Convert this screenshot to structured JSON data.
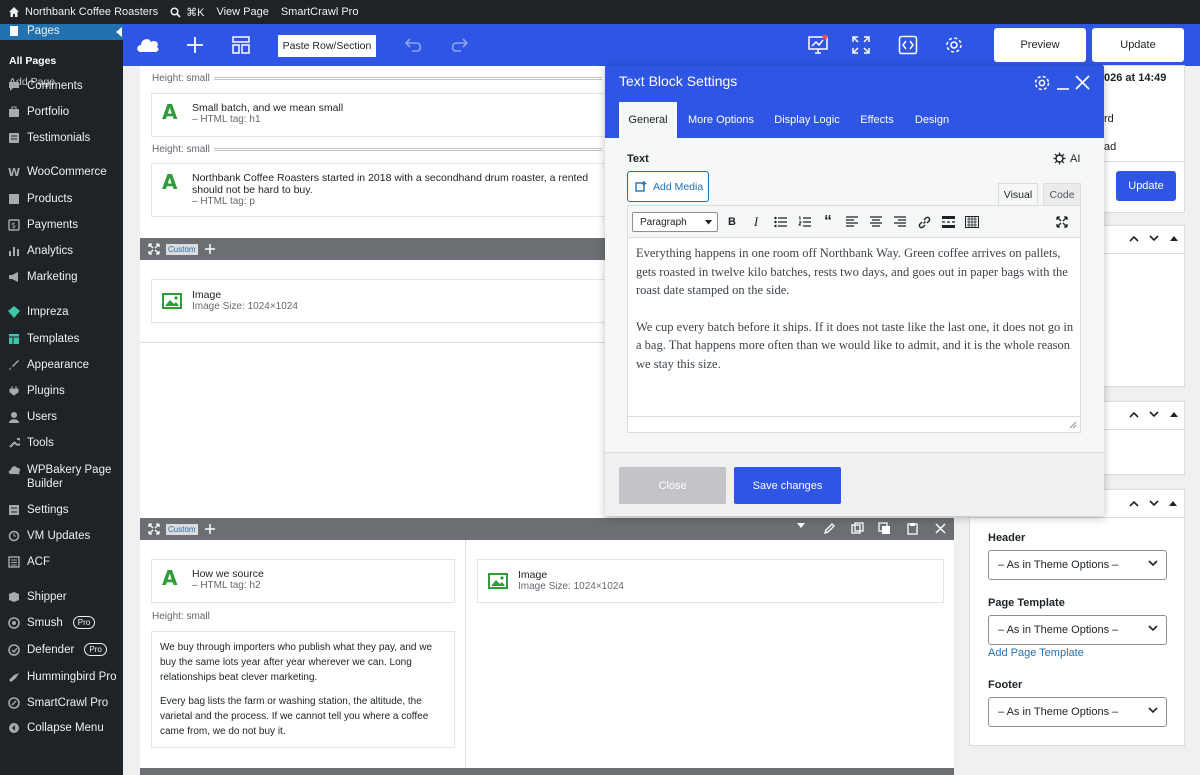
{
  "admin_bar": {
    "site_name": "Northbank Coffee Roasters",
    "search_shortcut": "⌘K",
    "view_page": "View Page",
    "plugin": "SmartCrawl Pro"
  },
  "sidebar": {
    "current": "Pages",
    "sub_items": [
      "All Pages",
      "Add Page"
    ],
    "items": [
      {
        "label": "Comments",
        "icon": "comments-icon"
      },
      {
        "label": "Portfolio",
        "icon": "portfolio-icon"
      },
      {
        "label": "Testimonials",
        "icon": "testimonials-icon"
      },
      {
        "label": "WooCommerce",
        "icon": "woocommerce-icon"
      },
      {
        "label": "Products",
        "icon": "products-icon"
      },
      {
        "label": "Payments",
        "icon": "payments-icon"
      },
      {
        "label": "Analytics",
        "icon": "analytics-icon"
      },
      {
        "label": "Marketing",
        "icon": "marketing-icon"
      },
      {
        "label": "Impreza",
        "icon": "impreza-icon"
      },
      {
        "label": "Templates",
        "icon": "templates-icon"
      },
      {
        "label": "Appearance",
        "icon": "appearance-icon"
      },
      {
        "label": "Plugins",
        "icon": "plugins-icon"
      },
      {
        "label": "Users",
        "icon": "users-icon"
      },
      {
        "label": "Tools",
        "icon": "tools-icon"
      },
      {
        "label": "WPBakery Page Builder",
        "icon": "wpbakery-icon"
      },
      {
        "label": "Settings",
        "icon": "settings-icon"
      },
      {
        "label": "VM Updates",
        "icon": "updates-icon"
      },
      {
        "label": "ACF",
        "icon": "acf-icon"
      },
      {
        "label": "Shipper",
        "icon": "shipper-icon"
      },
      {
        "label": "Smush",
        "icon": "smush-icon",
        "badge": "Pro"
      },
      {
        "label": "Defender",
        "icon": "defender-icon",
        "badge": "Pro"
      },
      {
        "label": "Hummingbird Pro",
        "icon": "hummingbird-icon"
      },
      {
        "label": "SmartCrawl Pro",
        "icon": "smartcrawl-icon"
      },
      {
        "label": "Collapse Menu",
        "icon": "collapse-icon"
      }
    ]
  },
  "toolbar": {
    "paste_label": "Paste Row/Section",
    "preview_label": "Preview",
    "update_label": "Update"
  },
  "canvas": {
    "height_label": "Height: small",
    "custom_label": "Custom",
    "elements": [
      {
        "title": "Small batch, and we mean small",
        "sub": "– HTML tag: h1"
      },
      {
        "title": "Northbank Coffee Roasters started in 2018 with a secondhand drum roaster, a rented",
        "title2": "should not be hard to buy.",
        "sub": "– HTML tag: p"
      },
      {
        "title": "Image",
        "sub": "Image Size: 1024×1024"
      },
      {
        "title": "How we source",
        "sub": "– HTML tag: h2"
      },
      {
        "title": "Image",
        "sub": "Image Size: 1024×1024"
      }
    ],
    "text_block": {
      "p1": "We buy through importers who publish what they pay, and we buy the same lots year after year wherever we can. Long relationships beat clever marketing.",
      "p2": "Every bag lists the farm or washing station, the altitude, the varietal and the process. If we cannot tell you where a coffee came from, we do not buy it."
    }
  },
  "modal": {
    "title": "Text Block Settings",
    "tabs": [
      "General",
      "More Options",
      "Display Logic",
      "Effects",
      "Design"
    ],
    "active_tab": "General",
    "field_label": "Text",
    "ai_label": "AI",
    "add_media": "Add Media",
    "visual_tab": "Visual",
    "code_tab": "Code",
    "format_select": "Paragraph",
    "paragraphs": [
      "Everything happens in one room off Northbank Way. Green coffee arrives on pallets, gets roasted in twelve kilo batches, rests two days, and goes out in paper bags with the roast date stamped on the side.",
      "We cup every batch before it ships. If it does not taste like the last one, it does not go in a bag. That happens more often than we would like to admit, and it is the whole reason we stay this size."
    ],
    "close_label": "Close",
    "save_label": "Save changes"
  },
  "right_panel": {
    "date_fragment": "026 at 14:49",
    "frag1": "rd",
    "frag2": "ad",
    "update_label": "Update",
    "header_label": "Header",
    "header_value": "– As in Theme Options –",
    "template_label": "Page Template",
    "template_value": "– As in Theme Options –",
    "add_template": "Add Page Template",
    "footer_label": "Footer",
    "footer_value": "– As in Theme Options –"
  },
  "colors": {
    "accent": "#2e55e3",
    "sidebar": "#1d2327",
    "green_icon": "#2e9c3a"
  }
}
